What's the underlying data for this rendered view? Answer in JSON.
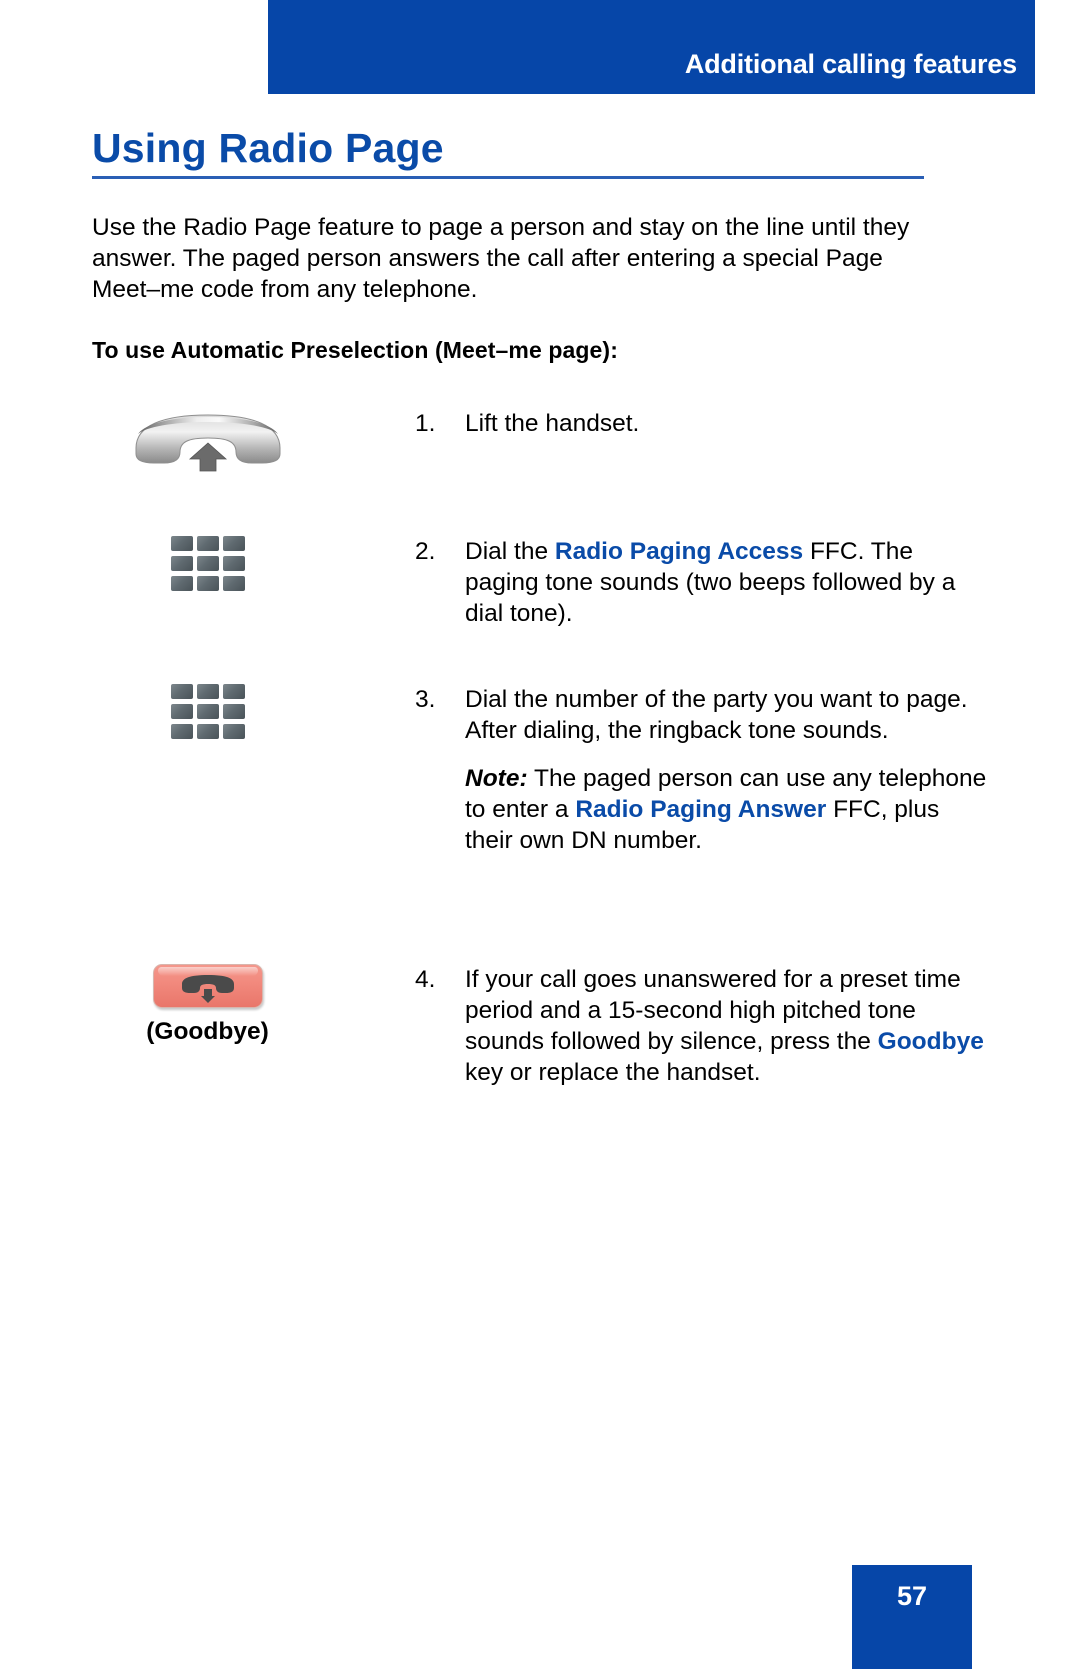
{
  "header": {
    "title": "Additional calling features",
    "band_color": "#0646a8"
  },
  "page": {
    "title": "Using Radio Page",
    "title_color": "#0a4ba8",
    "intro": "Use the Radio Page feature to page a person and stay on the line until they answer. The paged person answers the call after entering a special Page Meet–me code from any telephone.",
    "subheading": "To use Automatic Preselection (Meet–me page):"
  },
  "steps": [
    {
      "number": "1.",
      "icon": "handset-lift-icon",
      "text_parts": [
        {
          "text": "Lift the handset.",
          "style": "normal"
        }
      ]
    },
    {
      "number": "2.",
      "icon": "dialpad-icon",
      "text_parts": [
        {
          "text": "Dial the ",
          "style": "normal"
        },
        {
          "text": "Radio Paging Access",
          "style": "blue-bold"
        },
        {
          "text": " FFC. The paging tone sounds (two beeps followed by a dial tone).",
          "style": "normal"
        }
      ]
    },
    {
      "number": "3.",
      "icon": "dialpad-icon",
      "text_parts": [
        {
          "text": "Dial the number of the party you want to page. After dialing, the ringback tone sounds.",
          "style": "normal"
        }
      ],
      "note_parts": [
        {
          "text": "Note:",
          "style": "bold-italic"
        },
        {
          "text": " The paged person can use any telephone to enter a ",
          "style": "normal"
        },
        {
          "text": "Radio Paging Answer",
          "style": "blue-bold"
        },
        {
          "text": " FFC, plus their own DN number.",
          "style": "normal"
        }
      ]
    },
    {
      "number": "4.",
      "icon": "goodbye-key-icon",
      "icon_label": "(Goodbye)",
      "text_parts": [
        {
          "text": "If your call goes unanswered for a preset time period and a 15-second high pitched tone sounds followed by silence, press the ",
          "style": "normal"
        },
        {
          "text": "Goodbye",
          "style": "blue-bold"
        },
        {
          "text": " key or replace the handset.",
          "style": "normal"
        }
      ]
    }
  ],
  "footer": {
    "page_number": "57",
    "box_color": "#0646a8"
  }
}
